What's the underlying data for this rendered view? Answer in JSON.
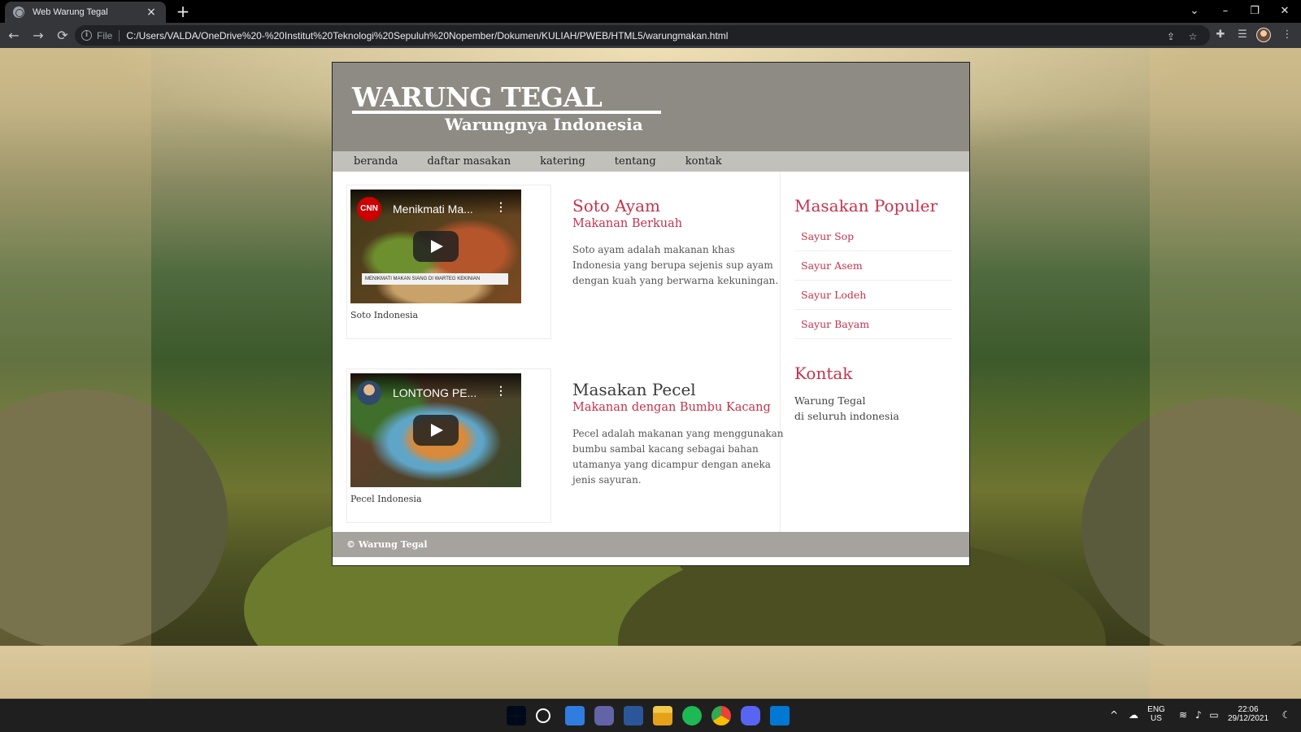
{
  "browser": {
    "tab_title": "Web Warung Tegal",
    "tab_close": "×",
    "new_tab": "+",
    "window_controls": {
      "tabsearch": "⌄",
      "minimize": "–",
      "restore": "❐",
      "close": "✕"
    },
    "nav": {
      "back": "←",
      "forward": "→",
      "reload": "⟳"
    },
    "address": {
      "info": "i",
      "scheme_label": "File",
      "url": "C:/Users/VALDA/OneDrive%20-%20Institut%20Teknologi%20Sepuluh%20Nopember/Dokumen/KULIAH/PWEB/HTML5/warungmakan.html"
    },
    "icons": {
      "share": "⇪",
      "bookmark": "☆",
      "extensions": "✚",
      "reading_list": "☰",
      "menu": "⋮"
    }
  },
  "site": {
    "brand": "WARUNG TEGAL",
    "tagline": "Warungnya Indonesia",
    "nav": [
      "beranda",
      "daftar masakan",
      "katering",
      "tentang",
      "kontak"
    ],
    "articles": [
      {
        "video_title": "Menikmati Ma...",
        "video_overlay": "MENIKMATI MAKAN SIANG DI WARTEG KEKINIAN",
        "channel": "CNN",
        "caption": "Soto Indonesia",
        "title": "Soto Ayam",
        "subtitle": "Makanan Berkuah",
        "body": "Soto ayam adalah makanan khas Indonesia yang berupa sejenis sup ayam dengan kuah yang berwarna kekuningan."
      },
      {
        "video_title": "LONTONG PE...",
        "caption": "Pecel Indonesia",
        "title": "Masakan Pecel",
        "subtitle": "Makanan dengan Bumbu Kacang",
        "body": "Pecel adalah makanan yang menggunakan bumbu sambal kacang sebagai bahan utamanya yang dicampur dengan aneka jenis sayuran."
      }
    ],
    "sidebar": {
      "popular_title": "Masakan Populer",
      "popular": [
        "Sayur Sop",
        "Sayur Asem",
        "Sayur Lodeh",
        "Sayur Bayam"
      ],
      "contact_title": "Kontak",
      "contact_lines": [
        "Warung Tegal",
        "di seluruh indonesia"
      ]
    },
    "footer": "© Warung Tegal",
    "colors": {
      "accent": "#c4334d",
      "header": "#8e8b85",
      "nav": "#c2c0bb",
      "footer": "#a6a39e"
    }
  },
  "taskbar": {
    "lang_top": "ENG",
    "lang_bottom": "US",
    "time": "22:06",
    "date": "29/12/2021",
    "tray_up": "^"
  }
}
